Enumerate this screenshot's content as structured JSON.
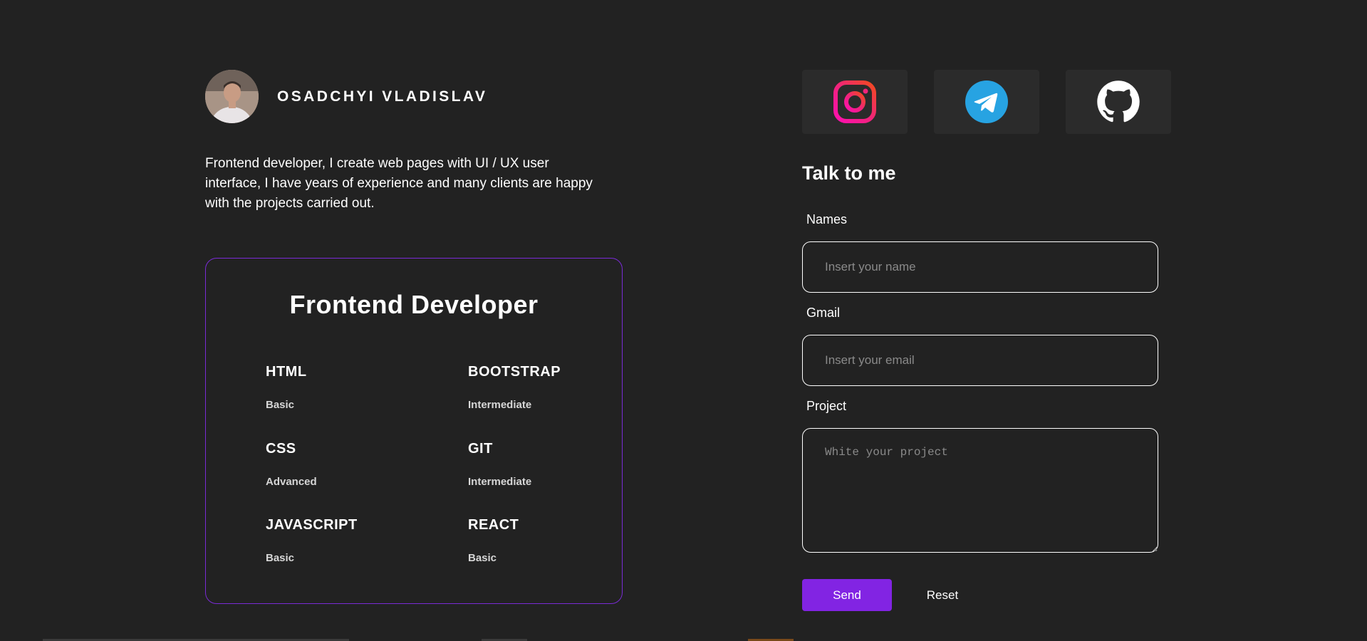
{
  "profile": {
    "name": "OSADCHYI VLADISLAV",
    "bio": "Frontend developer, I create web pages with UI / UX user interface, I have years of experience and many clients are happy with the projects carried out."
  },
  "skills": {
    "title": "Frontend Developer",
    "items": [
      {
        "name": "HTML",
        "level": "Basic"
      },
      {
        "name": "BOOTSTRAP",
        "level": "Intermediate"
      },
      {
        "name": "CSS",
        "level": "Advanced"
      },
      {
        "name": "GIT",
        "level": "Intermediate"
      },
      {
        "name": "JAVASCRIPT",
        "level": "Basic"
      },
      {
        "name": "REACT",
        "level": "Basic"
      }
    ],
    "border_color": "#7a2bd6"
  },
  "social": [
    {
      "icon": "instagram-icon"
    },
    {
      "icon": "telegram-icon"
    },
    {
      "icon": "github-icon"
    }
  ],
  "contact": {
    "title": "Talk to me",
    "name_label": "Names",
    "name_placeholder": "Insert your name",
    "email_label": "Gmail",
    "email_placeholder": "Insert your email",
    "project_label": "Project",
    "project_placeholder": "White your project",
    "send_label": "Send",
    "reset_label": "Reset"
  },
  "colors": {
    "background": "#222222",
    "accent": "#8224e3",
    "tile": "#2b2b2b"
  }
}
